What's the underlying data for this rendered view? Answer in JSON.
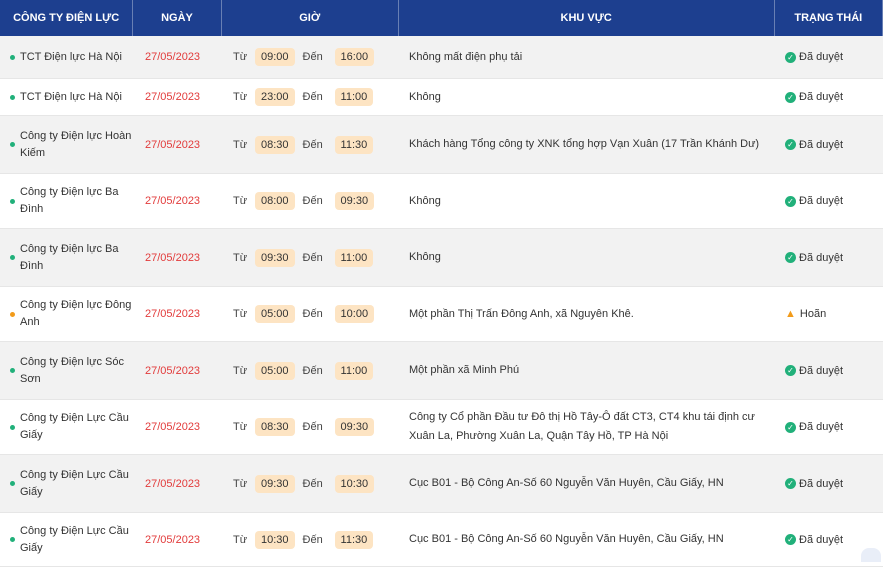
{
  "headers": {
    "company": "CÔNG TY ĐIỆN LỰC",
    "date": "NGÀY",
    "time": "GIỜ",
    "area": "KHU VỰC",
    "status": "TRẠNG THÁI"
  },
  "labels": {
    "from": "Từ",
    "to": "Đến"
  },
  "rows": [
    {
      "company": "TCT Điện lực Hà Nội",
      "date": "27/05/2023",
      "start": "09:00",
      "end": "16:00",
      "area": "Không mất điện phụ tải",
      "status": "Đã duyệt",
      "status_type": "approved"
    },
    {
      "company": "TCT Điện lực Hà Nội",
      "date": "27/05/2023",
      "start": "23:00",
      "end": "11:00",
      "area": "Không",
      "status": "Đã duyệt",
      "status_type": "approved"
    },
    {
      "company": "Công ty Điện lực Hoàn Kiếm",
      "date": "27/05/2023",
      "start": "08:30",
      "end": "11:30",
      "area": "Khách hàng Tổng công ty XNK tổng hợp Vạn Xuân (17 Trần Khánh Dư)",
      "status": "Đã duyệt",
      "status_type": "approved"
    },
    {
      "company": "Công ty Điện lực Ba Đình",
      "date": "27/05/2023",
      "start": "08:00",
      "end": "09:30",
      "area": "Không",
      "status": "Đã duyệt",
      "status_type": "approved"
    },
    {
      "company": "Công ty Điện lực Ba Đình",
      "date": "27/05/2023",
      "start": "09:30",
      "end": "11:00",
      "area": "Không",
      "status": "Đã duyệt",
      "status_type": "approved"
    },
    {
      "company": "Công ty Điện lực Đông Anh",
      "date": "27/05/2023",
      "start": "05:00",
      "end": "10:00",
      "area": "Một phần Thị Trấn Đông Anh, xã Nguyên Khê.",
      "status": "Hoãn",
      "status_type": "postponed"
    },
    {
      "company": "Công ty Điện lực Sóc Sơn",
      "date": "27/05/2023",
      "start": "05:00",
      "end": "11:00",
      "area": "Một phần xã Minh Phú",
      "status": "Đã duyệt",
      "status_type": "approved"
    },
    {
      "company": "Công ty Điện Lực Cầu Giấy",
      "date": "27/05/2023",
      "start": "08:30",
      "end": "09:30",
      "area": "Công ty Cổ phần Đầu tư Đô thị Hồ Tây-Ô đất CT3, CT4 khu tái định cư Xuân La, Phường Xuân La, Quận Tây Hồ, TP Hà Nội",
      "status": "Đã duyệt",
      "status_type": "approved"
    },
    {
      "company": "Công ty Điện Lực Cầu Giấy",
      "date": "27/05/2023",
      "start": "09:30",
      "end": "10:30",
      "area": "Cục B01 - Bộ Công An-Số 60 Nguyễn Văn Huyên, Cầu Giấy, HN",
      "status": "Đã duyệt",
      "status_type": "approved"
    },
    {
      "company": "Công ty Điện Lực Cầu Giấy",
      "date": "27/05/2023",
      "start": "10:30",
      "end": "11:30",
      "area": "Cục B01 - Bộ Công An-Số 60 Nguyễn Văn Huyên, Cầu Giấy, HN",
      "status": "Đã duyệt",
      "status_type": "approved"
    }
  ]
}
